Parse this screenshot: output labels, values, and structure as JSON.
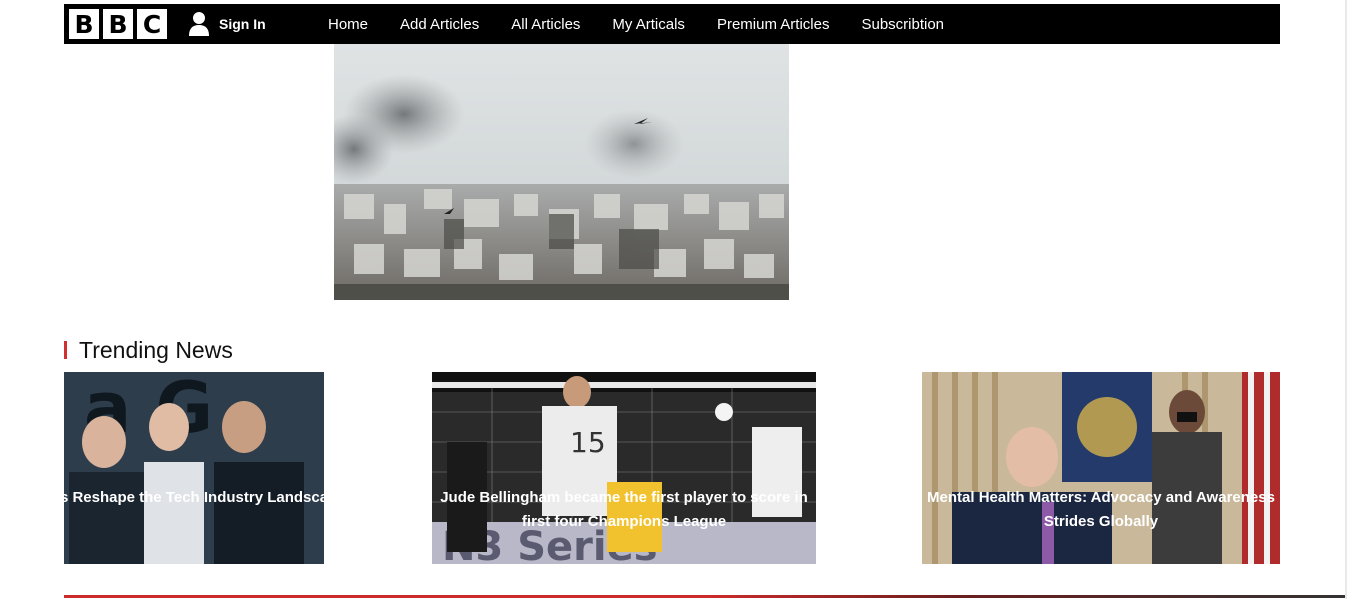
{
  "brand": {
    "logo_letters": [
      "B",
      "B",
      "C"
    ]
  },
  "auth": {
    "signin_label": "Sign In"
  },
  "nav": {
    "items": [
      {
        "label": "Home"
      },
      {
        "label": "Add Articles"
      },
      {
        "label": "All Articles"
      },
      {
        "label": "My Articals"
      },
      {
        "label": "Premium Articles"
      },
      {
        "label": "Subscribtion"
      }
    ]
  },
  "trending": {
    "title": "Trending News",
    "cards": [
      {
        "caption": "s Reshape the Tech Industry Landsca"
      },
      {
        "caption": "Jude Bellingham became the first player to score in first four Champions League"
      },
      {
        "caption": "Mental Health Matters: Advocacy and Awareness Strides Globally"
      }
    ]
  },
  "colors": {
    "navbar": "#000000",
    "accent": "#d32f2f",
    "text": "#111111"
  }
}
